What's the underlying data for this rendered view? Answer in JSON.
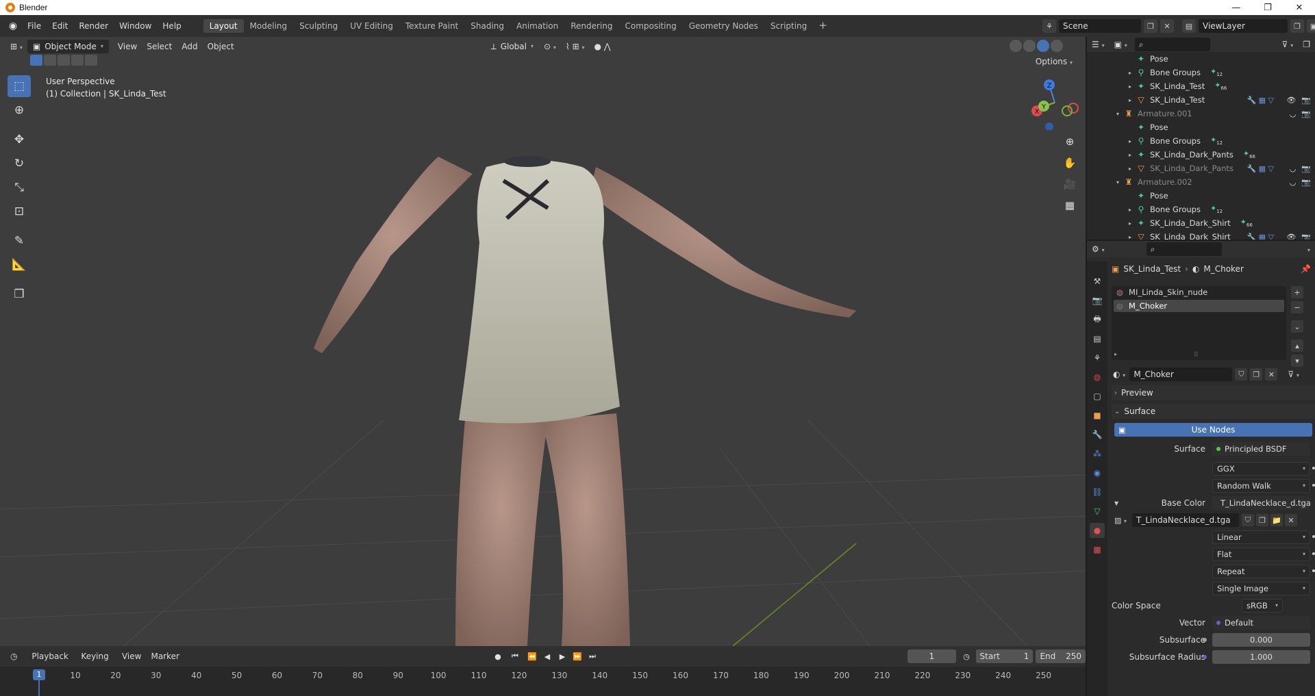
{
  "window": {
    "title": "Blender",
    "controls": [
      "—",
      "❐",
      "✕"
    ]
  },
  "menubar": {
    "menus": [
      "File",
      "Edit",
      "Render",
      "Window",
      "Help"
    ],
    "workspaces": [
      "Layout",
      "Modeling",
      "Sculpting",
      "UV Editing",
      "Texture Paint",
      "Shading",
      "Animation",
      "Rendering",
      "Compositing",
      "Geometry Nodes",
      "Scripting"
    ],
    "active_workspace": "Layout",
    "add_tab": "+",
    "scene": "Scene",
    "view_layer": "ViewLayer"
  },
  "viewport": {
    "mode": "Object Mode",
    "menus": [
      "View",
      "Select",
      "Add",
      "Object"
    ],
    "orientation": "Global",
    "options": "Options",
    "info_line1": "User Perspective",
    "info_line2": "(1) Collection | SK_Linda_Test",
    "gizmo": {
      "x": "X",
      "y": "Y",
      "z": "Z"
    }
  },
  "timeline": {
    "menus": [
      "Playback",
      "Keying",
      "View",
      "Marker"
    ],
    "current_frame": "1",
    "start_label": "Start",
    "start": "1",
    "end_label": "End",
    "end": "250",
    "ruler": [
      "10",
      "20",
      "30",
      "40",
      "50",
      "60",
      "70",
      "80",
      "90",
      "100",
      "110",
      "120",
      "130",
      "140",
      "150",
      "160",
      "170",
      "180",
      "190",
      "200",
      "210",
      "220",
      "230",
      "240",
      "250"
    ],
    "ruler_current": "1"
  },
  "outliner": {
    "rows": [
      {
        "label": "Pose",
        "indent": 3,
        "icon": "pose-icon",
        "glyph": "✦",
        "color": "#4fc9a8",
        "tri": ""
      },
      {
        "label": "Bone Groups",
        "indent": 3,
        "icon": "bone-group-icon",
        "glyph": "⚲",
        "color": "#4fc9a8",
        "tri": "▸",
        "badge": "12"
      },
      {
        "label": "SK_Linda_Test",
        "indent": 3,
        "icon": "armature-data-icon",
        "glyph": "✦",
        "color": "#4fc9a8",
        "tri": "▸",
        "badge": "66"
      },
      {
        "label": "SK_Linda_Test",
        "indent": 3,
        "icon": "mesh-icon",
        "glyph": "▽",
        "color": "#e8a04a",
        "tri": "▸",
        "vis": true
      },
      {
        "label": "Armature.001",
        "indent": 2,
        "icon": "armature-icon",
        "glyph": "♜",
        "color": "#e8a04a",
        "tri": "▾",
        "dim": true
      },
      {
        "label": "Pose",
        "indent": 3,
        "icon": "pose-icon",
        "glyph": "✦",
        "color": "#4fc9a8",
        "tri": ""
      },
      {
        "label": "Bone Groups",
        "indent": 3,
        "icon": "bone-group-icon",
        "glyph": "⚲",
        "color": "#4fc9a8",
        "tri": "▸",
        "badge": "12"
      },
      {
        "label": "SK_Linda_Dark_Pants",
        "indent": 3,
        "icon": "armature-data-icon",
        "glyph": "✦",
        "color": "#4fc9a8",
        "tri": "▸",
        "badge": "66"
      },
      {
        "label": "SK_Linda_Dark_Pants",
        "indent": 3,
        "icon": "mesh-icon",
        "glyph": "▽",
        "color": "#e8a04a",
        "tri": "▸",
        "dim": true
      },
      {
        "label": "Armature.002",
        "indent": 2,
        "icon": "armature-icon",
        "glyph": "♜",
        "color": "#e8a04a",
        "tri": "▾",
        "dim": true
      },
      {
        "label": "Pose",
        "indent": 3,
        "icon": "pose-icon",
        "glyph": "✦",
        "color": "#4fc9a8",
        "tri": ""
      },
      {
        "label": "Bone Groups",
        "indent": 3,
        "icon": "bone-group-icon",
        "glyph": "⚲",
        "color": "#4fc9a8",
        "tri": "▸",
        "badge": "12"
      },
      {
        "label": "SK_Linda_Dark_Shirt",
        "indent": 3,
        "icon": "armature-data-icon",
        "glyph": "✦",
        "color": "#4fc9a8",
        "tri": "▸",
        "badge": "66"
      },
      {
        "label": "SK_Linda_Dark_Shirt",
        "indent": 3,
        "icon": "mesh-icon",
        "glyph": "▽",
        "color": "#e8a04a",
        "tri": "▸",
        "vis": true
      }
    ]
  },
  "properties": {
    "breadcrumb_object": "SK_Linda_Test",
    "breadcrumb_material": "M_Choker",
    "slots": [
      "MI_Linda_Skin_nude",
      "M_Choker"
    ],
    "active_slot": "M_Choker",
    "material_name": "M_Choker",
    "preview_label": "Preview",
    "surface_panel": "Surface",
    "use_nodes": "Use Nodes",
    "surface_label": "Surface",
    "surface_value": "Principled BSDF",
    "distribution": "GGX",
    "subsurface_method": "Random Walk",
    "base_color_label": "Base Color",
    "base_color_value": "T_LindaNecklace_d.tga",
    "image_name": "T_LindaNecklace_d.tga",
    "interpolation": "Linear",
    "projection": "Flat",
    "extension": "Repeat",
    "source": "Single Image",
    "color_space_label": "Color Space",
    "color_space_value": "sRGB",
    "vector_label": "Vector",
    "vector_value": "Default",
    "subsurface_label": "Subsurface",
    "subsurface_value": "0.000",
    "subsurface_radius_label": "Subsurface Radius",
    "subsurface_radius_value": "1.000"
  },
  "colors": {
    "accent": "#4772b3",
    "viewport_bg": "#3d3d3d"
  }
}
